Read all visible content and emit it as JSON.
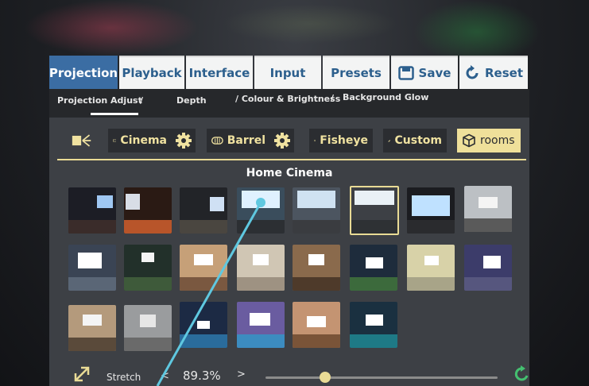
{
  "tabs": [
    {
      "label": "Projection",
      "active": true
    },
    {
      "label": "Playback"
    },
    {
      "label": "Interface"
    },
    {
      "label": "Input"
    },
    {
      "label": "Presets"
    },
    {
      "label": "Save",
      "icon": "save-icon"
    },
    {
      "label": "Reset",
      "icon": "reset-icon"
    }
  ],
  "subtabs": [
    "Projection Adjust",
    "/",
    "Depth",
    "/ Colour & Brightness",
    "/",
    "Background Glow"
  ],
  "modes": {
    "cinema": "Cinema",
    "barrel": "Barrel",
    "fisheye": "Fisheye",
    "custom": "Custom",
    "rooms": "rooms"
  },
  "section_title": "Home Cinema",
  "thumbnails": {
    "rows": [
      8,
      8,
      6
    ],
    "selected_index": 5
  },
  "bottom": {
    "stretch_label": "Stretch",
    "prev": "<",
    "value": "89.3%",
    "next": ">",
    "slider_fraction": 0.28
  },
  "colors": {
    "accent_blue": "#3b6da3",
    "accent_yellow": "#e9db95",
    "laser": "#5fc8e0"
  }
}
